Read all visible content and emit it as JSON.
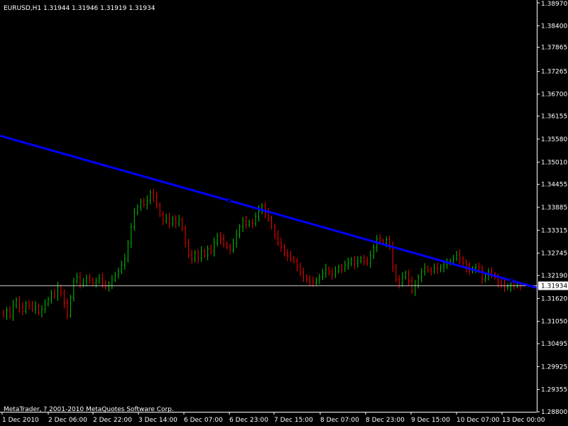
{
  "header": {
    "text": "EURUSD,H1  1.31944 1.31946 1.31919 1.31934"
  },
  "footer": {
    "text": "MetaTrader, ? 2001-2010 MetaQuotes Software Corp."
  },
  "colors": {
    "background": "#000000",
    "up": "#00c800",
    "down": "#ff0000",
    "axis": "#ffffff",
    "trendline": "#0000ff",
    "current_price_line": "#c0c0c0",
    "price_tag_bg": "#ffffff",
    "price_tag_text": "#000000"
  },
  "chart_data": {
    "type": "candlestick",
    "symbol": "EURUSD",
    "timeframe": "H1",
    "current_price": "1.31934",
    "ylim": [
      1.288,
      1.3897
    ],
    "y_ticks": [
      "1.38970",
      "1.38400",
      "1.37865",
      "1.37265",
      "1.36700",
      "1.36155",
      "1.35580",
      "1.35010",
      "1.34455",
      "1.33885",
      "1.33315",
      "1.32745",
      "1.32190",
      "1.31620",
      "1.31050",
      "1.30495",
      "1.29925",
      "1.29355",
      "1.28800"
    ],
    "x_ticks": [
      "1 Dec 2010",
      "2 Dec 06:00",
      "2 Dec 22:00",
      "3 Dec 14:00",
      "6 Dec 07:00",
      "6 Dec 23:00",
      "7 Dec 15:00",
      "8 Dec 07:00",
      "8 Dec 23:00",
      "9 Dec 15:00",
      "10 Dec 07:00",
      "13 Dec 00:00"
    ],
    "close_series": [
      1.312,
      1.3132,
      1.3118,
      1.3145,
      1.3158,
      1.314,
      1.313,
      1.315,
      1.3145,
      1.3135,
      1.3142,
      1.3128,
      1.3135,
      1.3148,
      1.316,
      1.3175,
      1.3168,
      1.319,
      1.3175,
      1.315,
      1.312,
      1.3165,
      1.3205,
      1.3215,
      1.3198,
      1.3205,
      1.3212,
      1.3208,
      1.32,
      1.3205,
      1.3212,
      1.32,
      1.3192,
      1.3195,
      1.3208,
      1.3222,
      1.323,
      1.3245,
      1.326,
      1.33,
      1.334,
      1.3375,
      1.339,
      1.3402,
      1.3395,
      1.3405,
      1.3425,
      1.3415,
      1.3395,
      1.337,
      1.3355,
      1.3362,
      1.3348,
      1.336,
      1.335,
      1.3358,
      1.3335,
      1.33,
      1.327,
      1.326,
      1.3275,
      1.3262,
      1.328,
      1.3268,
      1.3285,
      1.3278,
      1.33,
      1.3318,
      1.331,
      1.3298,
      1.329,
      1.3282,
      1.33,
      1.332,
      1.334,
      1.3355,
      1.3345,
      1.3352,
      1.3348,
      1.3365,
      1.338,
      1.3392,
      1.3375,
      1.3362,
      1.334,
      1.332,
      1.33,
      1.329,
      1.3275,
      1.3268,
      1.3262,
      1.3255,
      1.324,
      1.3225,
      1.3215,
      1.321,
      1.3205,
      1.32,
      1.3208,
      1.3215,
      1.3225,
      1.3235,
      1.3228,
      1.3222,
      1.323,
      1.324,
      1.3235,
      1.3245,
      1.325,
      1.3258,
      1.3248,
      1.3255,
      1.3262,
      1.3255,
      1.325,
      1.3268,
      1.329,
      1.331,
      1.3305,
      1.33,
      1.3308,
      1.329,
      1.324,
      1.321,
      1.32,
      1.3215,
      1.3225,
      1.3205,
      1.318,
      1.3195,
      1.3215,
      1.3228,
      1.3238,
      1.3232,
      1.323,
      1.3238,
      1.3235,
      1.324,
      1.3245,
      1.325,
      1.3255,
      1.3262,
      1.327,
      1.326,
      1.325,
      1.324,
      1.323,
      1.3236,
      1.324,
      1.3232,
      1.321,
      1.322,
      1.3228,
      1.3222,
      1.3215,
      1.32,
      1.3195,
      1.319,
      1.3192,
      1.3196,
      1.3193,
      1.3194,
      1.3193
    ],
    "trendline": {
      "points": [
        [
          "1 Dec 2010",
          1.3565
        ],
        [
          "6 Dec 23:00",
          1.3415
        ],
        [
          "10 Dec 07:00",
          1.3245
        ]
      ],
      "style": "solid",
      "width": 3
    }
  }
}
